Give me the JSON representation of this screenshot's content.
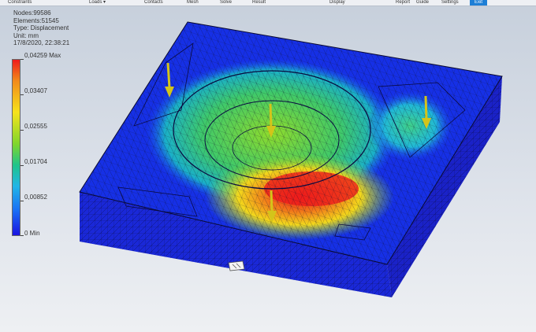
{
  "toolbar": {
    "items": [
      {
        "label": "Constraints"
      },
      {
        "label": "Loads ▾"
      },
      {
        "label": "Contacts"
      },
      {
        "label": "Mesh"
      },
      {
        "label": "Solve"
      },
      {
        "label": "Result"
      },
      {
        "label": "Display"
      },
      {
        "label": "Report"
      },
      {
        "label": "Guide"
      },
      {
        "label": "Settings"
      },
      {
        "label": "Exit"
      }
    ]
  },
  "info": {
    "nodes": "Nodes:99586",
    "elements": "Elements:51545",
    "type": "Type: Displacement",
    "unit": "Unit: mm",
    "datetime": "17/8/2020, 22:38:21"
  },
  "legend": {
    "max": "0,04259 Max",
    "v1": "0,03407",
    "v2": "0,02555",
    "v3": "0,01704",
    "v4": "0,00852",
    "min": "0 Min"
  },
  "colors": {
    "low": "#1a14e0",
    "mid": "#7fd62c",
    "high": "#ee1b1b",
    "load_arrow": "#d4c41a"
  },
  "icons": {
    "load_arrow": "down-arrow-icon",
    "fixed_constraint": "fixed-constraint-icon"
  }
}
